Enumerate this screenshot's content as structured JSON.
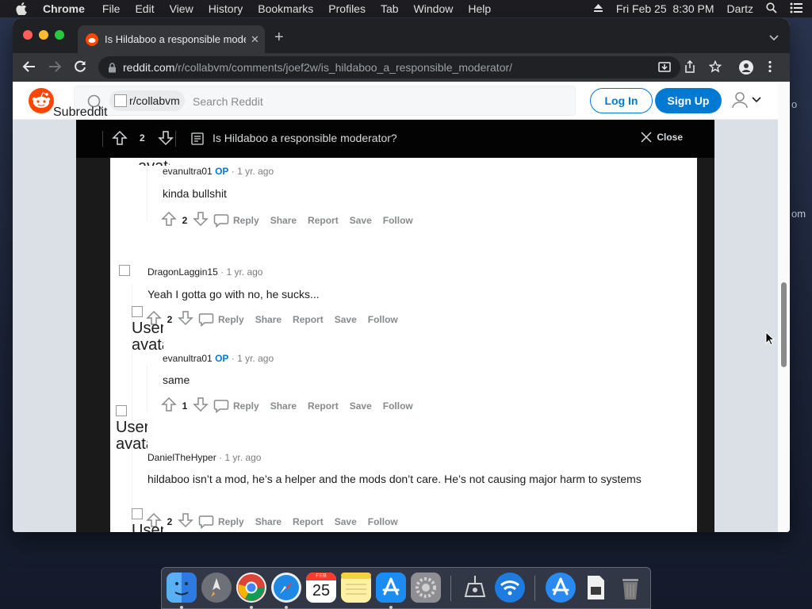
{
  "menubar": {
    "app": "Chrome",
    "items": [
      "File",
      "Edit",
      "View",
      "History",
      "Bookmarks",
      "Profiles",
      "Tab",
      "Window",
      "Help"
    ],
    "clock": "Fri Feb 25  8:30 PM",
    "user": "Dartz"
  },
  "desktop_peek": {
    "top": "o",
    "bottom": "om"
  },
  "browser": {
    "tab_title": "Is Hildaboo a responsible moderator",
    "url_host": "reddit.com",
    "url_path": "/r/collabvm/comments/joef2w/is_hildaboo_a_responsible_moderator/"
  },
  "reddit": {
    "subreddit_chip": "r/collabvm",
    "subreddit_chip_sub": "Subreddit",
    "search_placeholder": "Search Reddit",
    "login_label": "Log In",
    "signup_label": "Sign Up"
  },
  "post_bar": {
    "vote_count": "2",
    "title": "Is Hildaboo a responsible moderator?",
    "close_label": "Close"
  },
  "avatar_alt_text": "User avatar",
  "comments": [
    {
      "author": "evanultra01",
      "op": "OP",
      "age": "1 yr. ago",
      "body": "kinda bullshit",
      "votes": "2"
    },
    {
      "author": "DragonLaggin15",
      "op": "",
      "age": "1 yr. ago",
      "body": "Yeah I gotta go with no, he sucks...",
      "votes": "2"
    },
    {
      "author": "evanultra01",
      "op": "OP",
      "age": "1 yr. ago",
      "body": "same",
      "votes": "1"
    },
    {
      "author": "DanielTheHyper",
      "op": "",
      "age": "1 yr. ago",
      "body": "hildaboo isn’t a mod, he’s a helper and the mods don’t care. He’s not causing major harm to systems",
      "votes": "2"
    }
  ],
  "comment_actions": {
    "reply": "Reply",
    "share": "Share",
    "report": "Report",
    "save": "Save",
    "follow": "Follow"
  },
  "meta_separator": "·",
  "dock": {
    "calendar_month": "FEB",
    "calendar_day": "25",
    "apps": [
      "finder-icon",
      "launchpad-icon",
      "chrome-icon",
      "safari-icon",
      "calendar-icon",
      "notes-icon",
      "app-store-icon",
      "system-preferences-icon",
      "network-utility-icon",
      "wifi-icon",
      "app-store-downloads-icon",
      "document-icon",
      "trash-icon"
    ]
  },
  "colors": {
    "reddit_orange": "#ff4500",
    "reddit_blue": "#0079d3"
  }
}
